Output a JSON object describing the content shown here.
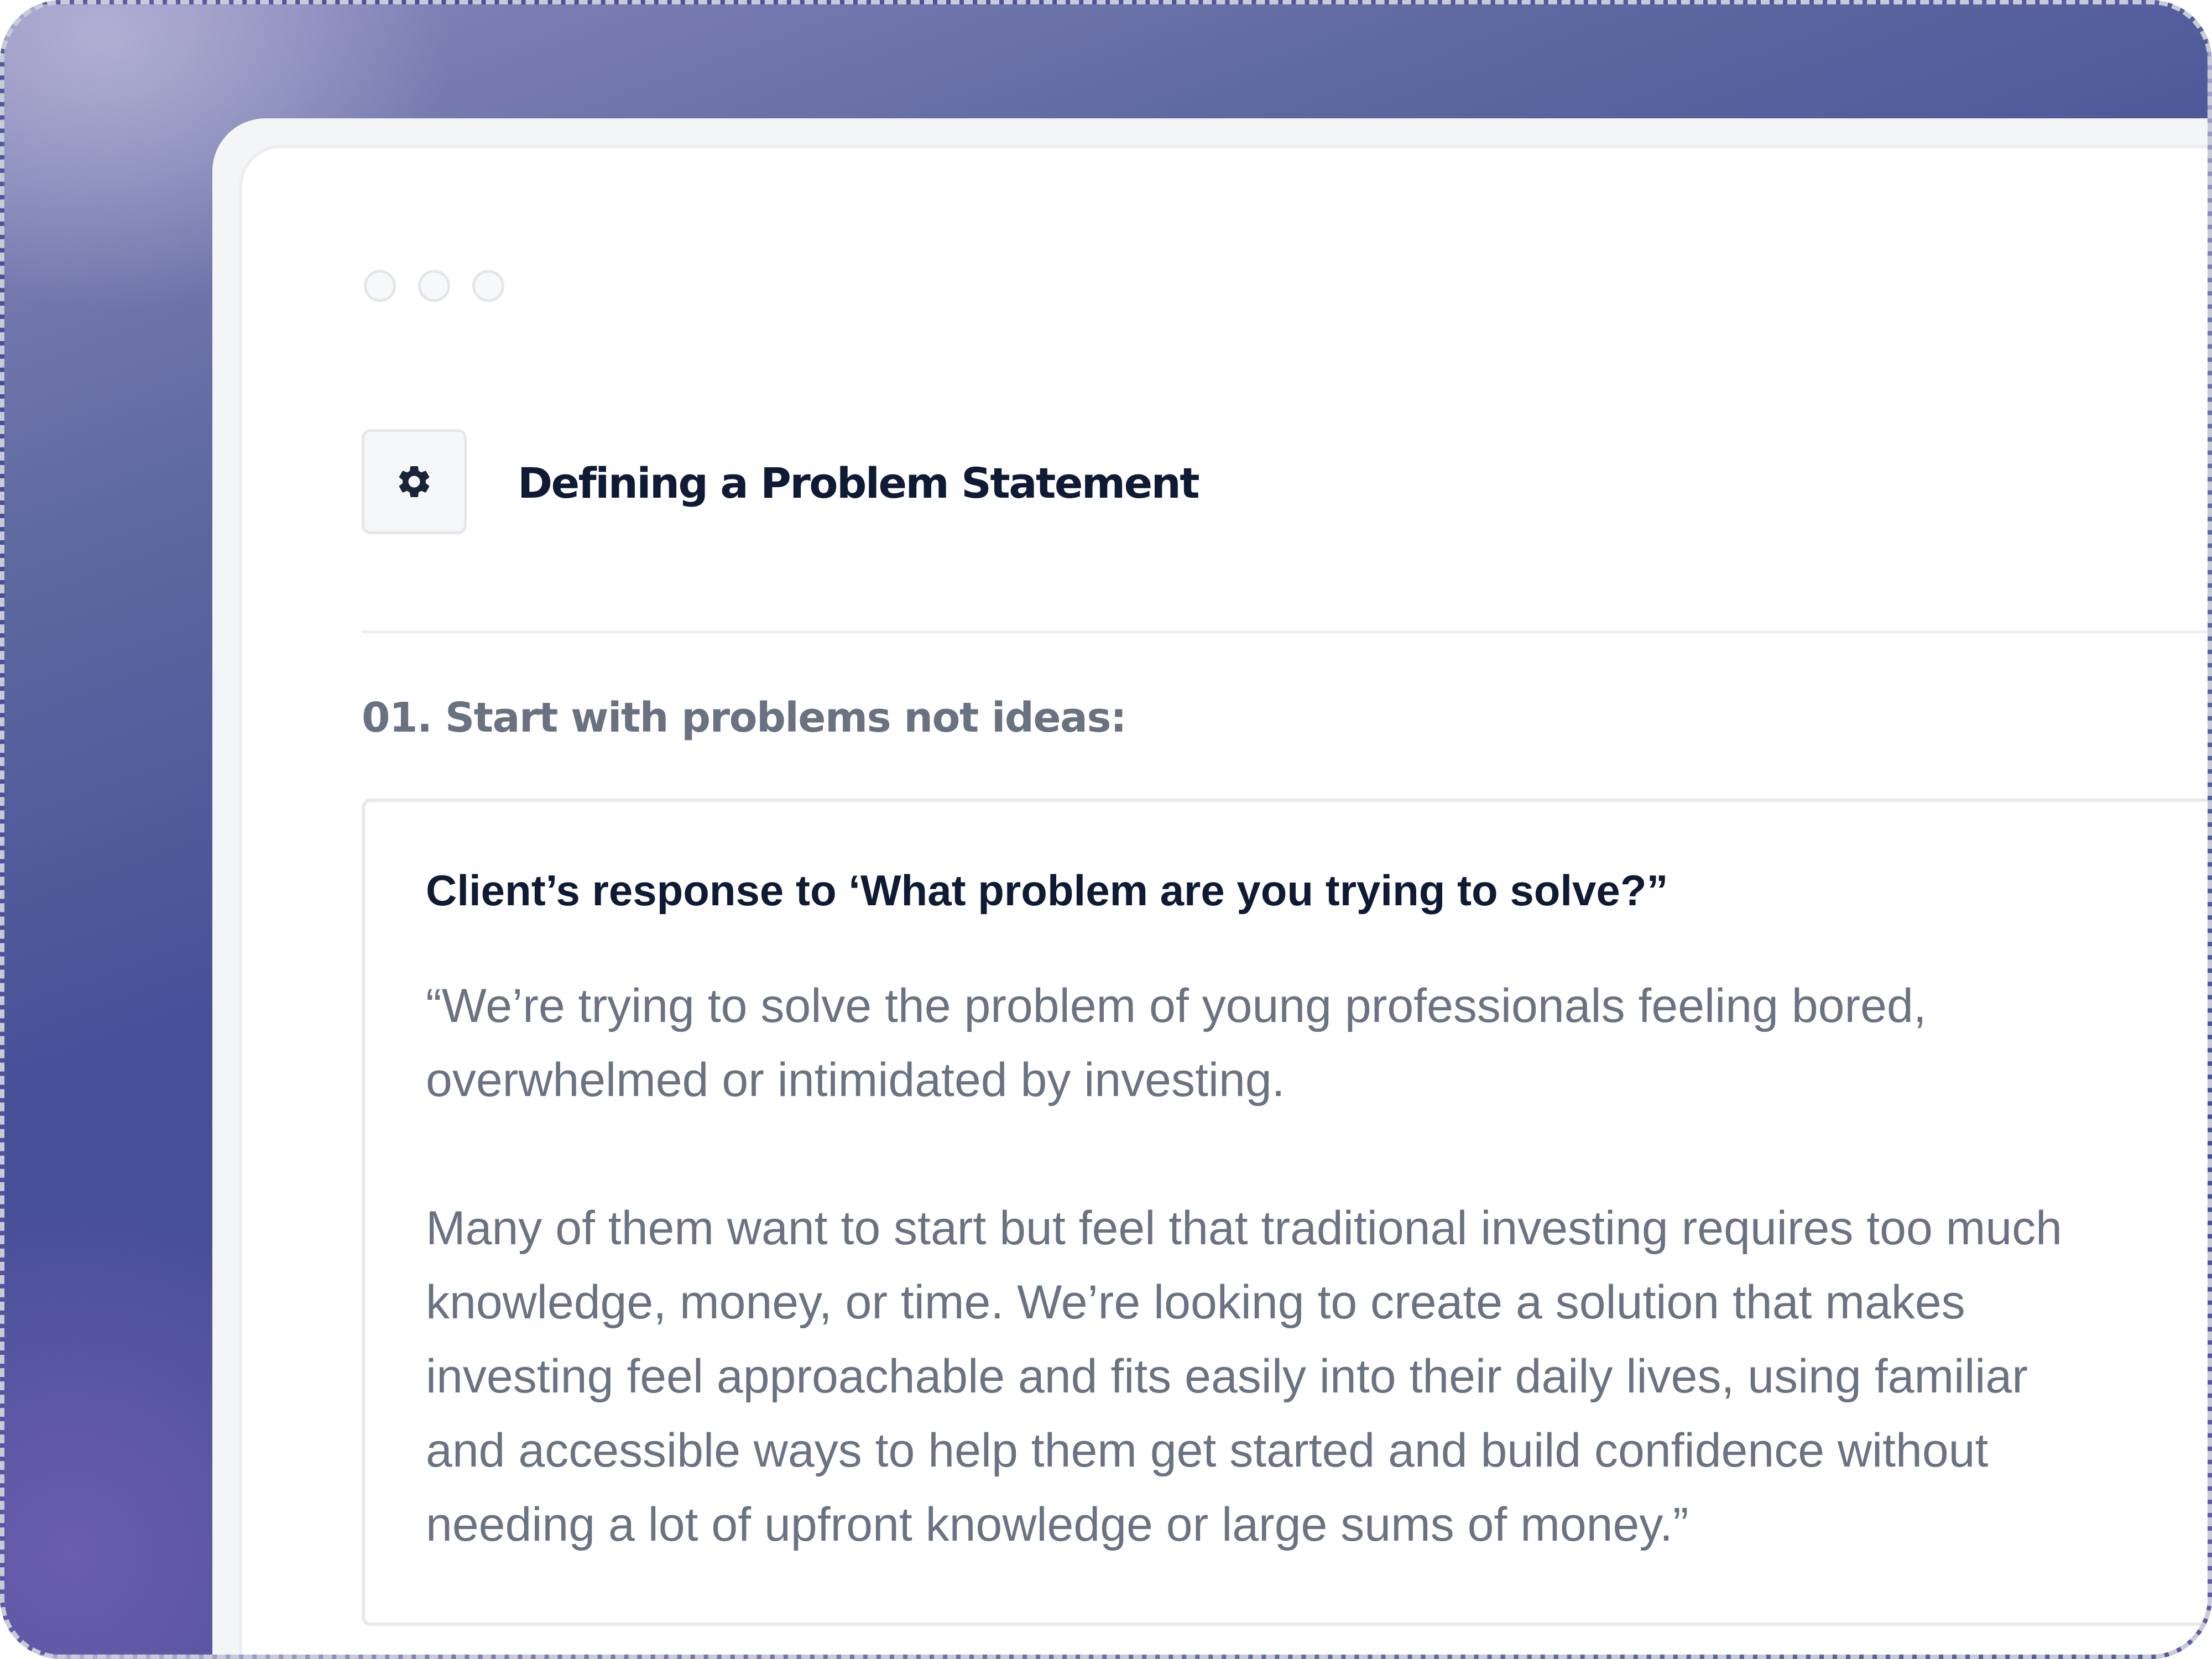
{
  "window": {
    "traffic_lights": [
      "close",
      "minimize",
      "maximize"
    ]
  },
  "header": {
    "icon": "gear-icon",
    "title": "Defining a Problem Statement"
  },
  "section": {
    "heading": "01. Start with problems not ideas:"
  },
  "card": {
    "title": "Client’s response to ‘What problem are you trying to solve?”",
    "paragraph_1_lines": [
      "“We’re trying to solve the problem of young professionals feeling bored,",
      "overwhelmed or intimidated by investing."
    ],
    "paragraph_2_lines": [
      "Many of them want to start but feel that traditional investing requires too much",
      "knowledge, money, or time. We’re looking to create a solution that makes",
      "investing feel approachable and fits easily into their daily lives, using familiar",
      "and accessible ways to help them get started and build confidence without",
      "needing a lot of upfront knowledge or large sums of money.”"
    ]
  },
  "colors": {
    "title_text": "#0f1a35",
    "muted_text": "#6b7383",
    "background_gradient_primary": "#475097"
  }
}
